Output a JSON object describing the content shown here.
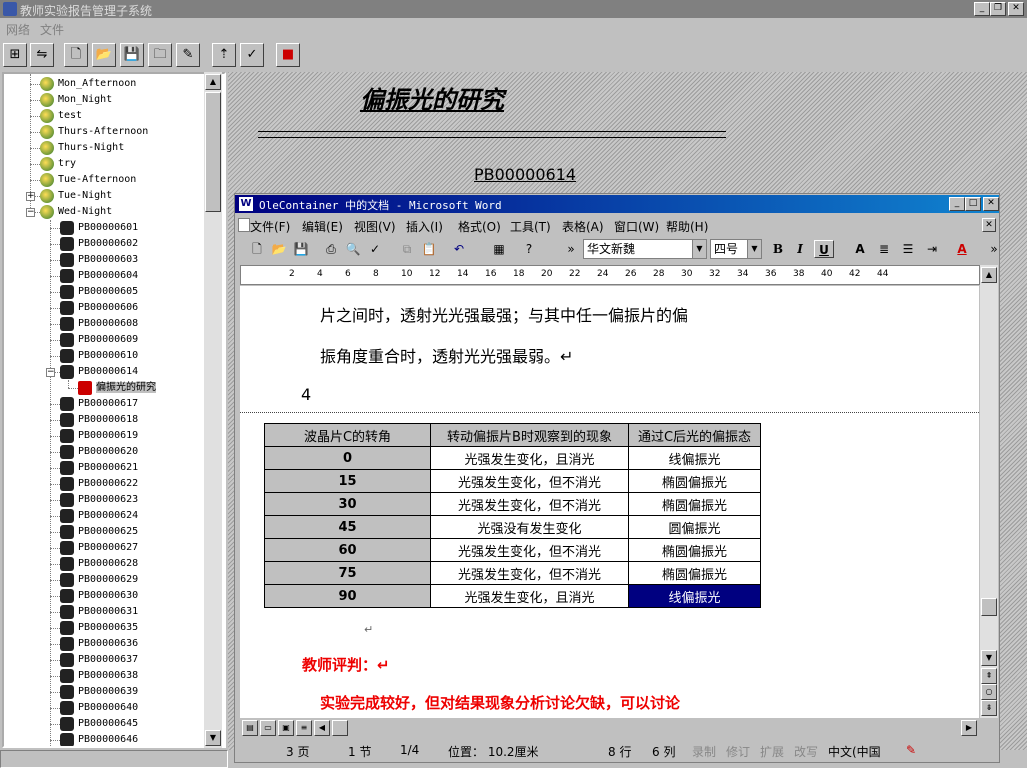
{
  "app": {
    "title": "教师实验报告管理子系统"
  },
  "menu": {
    "items": [
      "网络",
      "文件"
    ]
  },
  "tree": {
    "items": [
      {
        "label": "Mon_Afternoon",
        "type": "glb"
      },
      {
        "label": "Mon_Night",
        "type": "glb"
      },
      {
        "label": "test",
        "type": "glb"
      },
      {
        "label": "Thurs-Afternoon",
        "type": "glb"
      },
      {
        "label": "Thurs-Night",
        "type": "glb"
      },
      {
        "label": "try",
        "type": "glb"
      },
      {
        "label": "Tue-Afternoon",
        "type": "glb"
      },
      {
        "label": "Tue-Night",
        "type": "glb"
      },
      {
        "label": "Wed-Night",
        "type": "glb"
      },
      {
        "label": "PB00000601",
        "type": "usr"
      },
      {
        "label": "PB00000602",
        "type": "usr"
      },
      {
        "label": "PB00000603",
        "type": "usr"
      },
      {
        "label": "PB00000604",
        "type": "usr"
      },
      {
        "label": "PB00000605",
        "type": "usr"
      },
      {
        "label": "PB00000606",
        "type": "usr"
      },
      {
        "label": "PB00000608",
        "type": "usr"
      },
      {
        "label": "PB00000609",
        "type": "usr"
      },
      {
        "label": "PB00000610",
        "type": "usr"
      },
      {
        "label": "PB00000614",
        "type": "usr"
      },
      {
        "label": "偏振光的研究",
        "type": "doc"
      },
      {
        "label": "PB00000617",
        "type": "usr"
      },
      {
        "label": "PB00000618",
        "type": "usr"
      },
      {
        "label": "PB00000619",
        "type": "usr"
      },
      {
        "label": "PB00000620",
        "type": "usr"
      },
      {
        "label": "PB00000621",
        "type": "usr"
      },
      {
        "label": "PB00000622",
        "type": "usr"
      },
      {
        "label": "PB00000623",
        "type": "usr"
      },
      {
        "label": "PB00000624",
        "type": "usr"
      },
      {
        "label": "PB00000625",
        "type": "usr"
      },
      {
        "label": "PB00000627",
        "type": "usr"
      },
      {
        "label": "PB00000628",
        "type": "usr"
      },
      {
        "label": "PB00000629",
        "type": "usr"
      },
      {
        "label": "PB00000630",
        "type": "usr"
      },
      {
        "label": "PB00000631",
        "type": "usr"
      },
      {
        "label": "PB00000635",
        "type": "usr"
      },
      {
        "label": "PB00000636",
        "type": "usr"
      },
      {
        "label": "PB00000637",
        "type": "usr"
      },
      {
        "label": "PB00000638",
        "type": "usr"
      },
      {
        "label": "PB00000639",
        "type": "usr"
      },
      {
        "label": "PB00000640",
        "type": "usr"
      },
      {
        "label": "PB00000645",
        "type": "usr"
      },
      {
        "label": "PB00000646",
        "type": "usr"
      }
    ]
  },
  "report": {
    "title": "偏振光的研究",
    "student_id": "PB00000614"
  },
  "word": {
    "title": "OleContainer 中的文档 - Microsoft Word",
    "menu": [
      "文件(F)",
      "编辑(E)",
      "视图(V)",
      "插入(I)",
      "格式(O)",
      "工具(T)",
      "表格(A)",
      "窗口(W)",
      "帮助(H)"
    ],
    "font": "华文新魏",
    "size": "四号",
    "ruler": [
      "2",
      "4",
      "6",
      "8",
      "10",
      "12",
      "14",
      "16",
      "18",
      "20",
      "22",
      "24",
      "26",
      "28",
      "30",
      "32",
      "34",
      "36",
      "38",
      "40",
      "42",
      "44"
    ],
    "doc": {
      "line1": "片之间时，透射光光强最强；与其中任一偏振片的偏",
      "line2": "振角度重合时，透射光光强最弱。↵",
      "num": "4",
      "table": {
        "headers": [
          "波晶片C的转角",
          "转动偏振片B时观察到的现象",
          "通过C后光的偏振态"
        ],
        "rows": [
          [
            "0",
            "光强发生变化，且消光",
            "线偏振光"
          ],
          [
            "15",
            "光强发生变化，但不消光",
            "椭圆偏振光"
          ],
          [
            "30",
            "光强发生变化，但不消光",
            "椭圆偏振光"
          ],
          [
            "45",
            "光强没有发生变化",
            "圆偏振光"
          ],
          [
            "60",
            "光强发生变化，但不消光",
            "椭圆偏振光"
          ],
          [
            "75",
            "光强发生变化，但不消光",
            "椭圆偏振光"
          ],
          [
            "90",
            "光强发生变化，且消光",
            "线偏振光"
          ]
        ]
      },
      "para_mark": "↵",
      "comment_label": "教师评判：↵",
      "comment": "实验完成较好，但对结果现象分析讨论欠缺，可以讨论"
    },
    "status": {
      "page": "3 页",
      "section": "1 节",
      "pages": "1/4",
      "position": "位置： 10.2厘米",
      "line": "8 行",
      "col": "6 列",
      "rec": "录制",
      "trk": "修订",
      "ext": "扩展",
      "ovr": "改写",
      "lang": "中文(中国"
    }
  }
}
